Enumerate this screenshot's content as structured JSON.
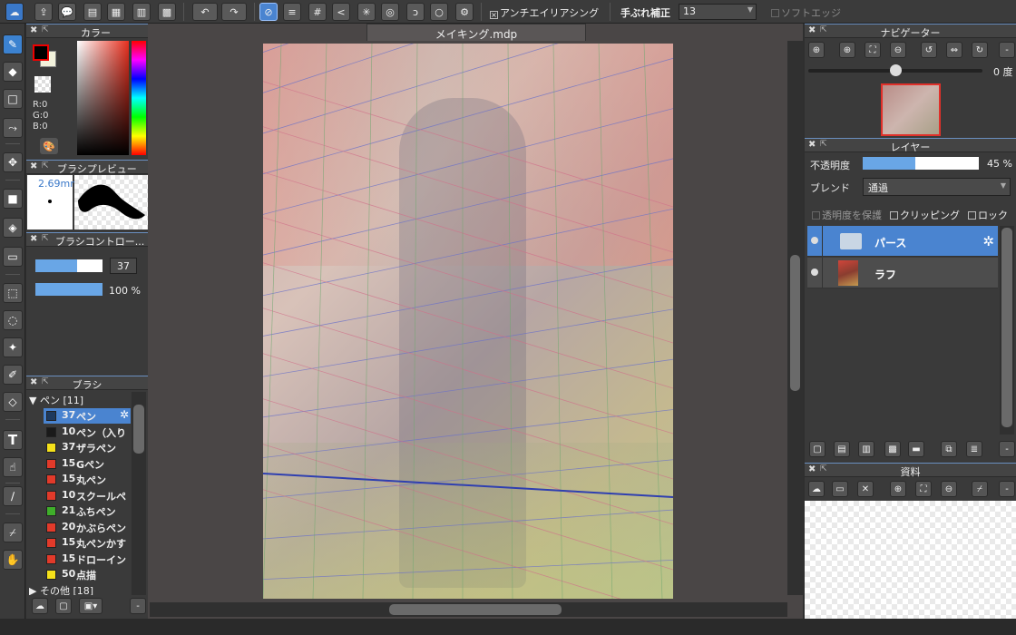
{
  "toolbar": {
    "antialias_label": "アンチエイリアシング",
    "stabilizer_label": "手ぶれ補正",
    "stabilizer_value": "13",
    "soft_edge_label": "ソフトエッジ"
  },
  "panels": {
    "color": {
      "title": "カラー",
      "r": "R:0",
      "g": "G:0",
      "b": "B:0"
    },
    "brush_preview": {
      "title": "ブラシプレビュー",
      "size_text": "2.69mm"
    },
    "brush_control": {
      "title": "ブラシコントロー...",
      "size_value": "37",
      "opacity_value": "100 %"
    },
    "brush": {
      "title": "ブラシ",
      "group_pen": "ペン [11]",
      "group_other": "その他 [18]",
      "items": [
        {
          "size": "37",
          "name": "ペン",
          "color": "#1e3a5f"
        },
        {
          "size": "10",
          "name": "ペン（入り",
          "color": "#1a1a1a"
        },
        {
          "size": "37",
          "name": "ザラペン",
          "color": "#f5e11a"
        },
        {
          "size": "15",
          "name": "Gペン",
          "color": "#e23a2a"
        },
        {
          "size": "15",
          "name": "丸ペン",
          "color": "#e23a2a"
        },
        {
          "size": "10",
          "name": "スクールペ",
          "color": "#e23a2a"
        },
        {
          "size": "21",
          "name": "ふちペン",
          "color": "#3fae2a"
        },
        {
          "size": "20",
          "name": "かぶらペン",
          "color": "#e23a2a"
        },
        {
          "size": "15",
          "name": "丸ペンかす",
          "color": "#e23a2a"
        },
        {
          "size": "15",
          "name": "ドローイン",
          "color": "#e23a2a"
        },
        {
          "size": "50",
          "name": "点描",
          "color": "#f5e11a"
        }
      ]
    },
    "navigator": {
      "title": "ナビゲーター",
      "angle": "0 度"
    },
    "layer": {
      "title": "レイヤー",
      "opacity_label": "不透明度",
      "opacity_value": "45 %",
      "opacity": 0.45,
      "blend_label": "ブレンド",
      "blend_value": "通過",
      "protect_label": "透明度を保護",
      "clipping_label": "クリッピング",
      "lock_label": "ロック",
      "layers": [
        {
          "name": "パース",
          "type": "folder",
          "selected": true
        },
        {
          "name": "ラフ",
          "type": "image",
          "selected": false
        }
      ]
    },
    "materials": {
      "title": "資料"
    }
  },
  "document": {
    "tab_title": "メイキング.mdp"
  },
  "colors": {
    "accent": "#4a84d0",
    "bg": "#3a3a3a",
    "canvas_bg": "#4a4646"
  }
}
